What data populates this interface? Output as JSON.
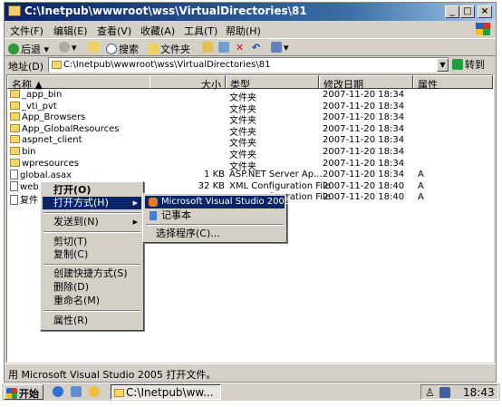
{
  "window": {
    "title": "C:\\Inetpub\\wwwroot\\wss\\VirtualDirectories\\81",
    "btn_min": "_",
    "btn_max": "□",
    "btn_close": "×"
  },
  "menu": [
    "文件(F)",
    "编辑(E)",
    "查看(V)",
    "收藏(A)",
    "工具(T)",
    "帮助(H)"
  ],
  "toolbar": {
    "back": "后退",
    "search": "搜索",
    "folders": "文件夹"
  },
  "address": {
    "label": "地址(D)",
    "value": "C:\\Inetpub\\wwwroot\\wss\\VirtualDirectories\\81",
    "go": "转到"
  },
  "columns": {
    "name": "名称",
    "size": "大小",
    "type": "类型",
    "modified": "修改日期",
    "attr": "属性"
  },
  "files": [
    {
      "name": "_app_bin",
      "size": "",
      "type": "文件夹",
      "modified": "2007-11-20 18:34",
      "attr": ""
    },
    {
      "name": "_vti_pvt",
      "size": "",
      "type": "文件夹",
      "modified": "2007-11-20 18:34",
      "attr": ""
    },
    {
      "name": "App_Browsers",
      "size": "",
      "type": "文件夹",
      "modified": "2007-11-20 18:34",
      "attr": ""
    },
    {
      "name": "App_GlobalResources",
      "size": "",
      "type": "文件夹",
      "modified": "2007-11-20 18:34",
      "attr": ""
    },
    {
      "name": "aspnet_client",
      "size": "",
      "type": "文件夹",
      "modified": "2007-11-20 18:34",
      "attr": ""
    },
    {
      "name": "bin",
      "size": "",
      "type": "文件夹",
      "modified": "2007-11-20 18:34",
      "attr": ""
    },
    {
      "name": "wpresources",
      "size": "",
      "type": "文件夹",
      "modified": "2007-11-20 18:34",
      "attr": ""
    },
    {
      "name": "global.asax",
      "size": "1 KB",
      "type": "ASP.NET Server Ap...",
      "modified": "2007-11-20 18:34",
      "attr": "A"
    },
    {
      "name": "web.",
      "size": "32 KB",
      "type": "XML Configuration File",
      "modified": "2007-11-20 18:40",
      "attr": "A"
    },
    {
      "name": "复件",
      "size": "32 KB",
      "type": "XML Configuration File",
      "modified": "2007-11-20 18:40",
      "attr": "A"
    }
  ],
  "context_menu": {
    "open": "打开(O)",
    "open_with": "打开方式(H)",
    "send_to": "发送到(N)",
    "cut": "剪切(T)",
    "copy": "复制(C)",
    "shortcut": "创建快捷方式(S)",
    "delete": "删除(D)",
    "rename": "重命名(M)",
    "properties": "属性(R)",
    "arrow": "▶"
  },
  "submenu": {
    "vs": "Microsoft Visual Studio 2005",
    "notepad": "记事本",
    "choose": "选择程序(C)..."
  },
  "status": "用 Microsoft Visual Studio 2005 打开文件。",
  "taskbar": {
    "start": "开始",
    "task": "C:\\Inetpub\\ww...",
    "time": "18:43"
  }
}
